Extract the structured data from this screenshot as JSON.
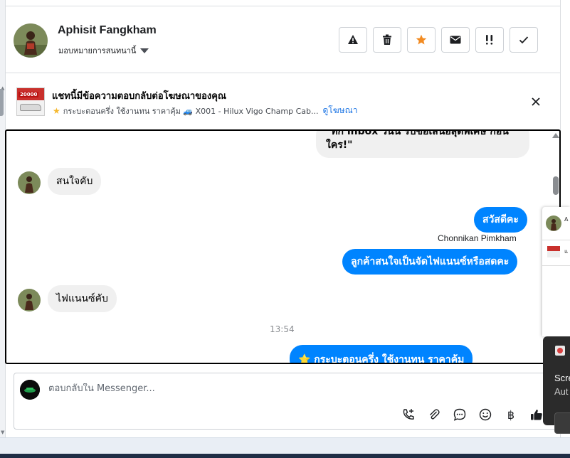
{
  "header": {
    "customer_name": "Aphisit Fangkham",
    "assign_label": "มอบหมายการสนทนานี้",
    "actions": [
      {
        "name": "report-spam-button",
        "icon": "warning-icon"
      },
      {
        "name": "delete-button",
        "icon": "trash-icon"
      },
      {
        "name": "star-button",
        "icon": "star-icon"
      },
      {
        "name": "mark-unread-button",
        "icon": "envelope-icon"
      },
      {
        "name": "follow-up-button",
        "icon": "important-icon"
      },
      {
        "name": "mark-done-button",
        "icon": "check-icon"
      }
    ]
  },
  "ad": {
    "title": "แชทนี้มีข้อความตอบกลับต่อโฆษณาของคุณ",
    "thumb_badge": "20000",
    "subtitle": "กระบะตอนครึ่ง ใช้งานทน ราคาคุ้ม 🚙 X001 - Hilux Vigo Champ Cab...",
    "link": "ดูโฆษณา"
  },
  "chat": {
    "top_bubble": "\"ทัก inbox วันนี้ รับข้อเสนอสุดพิเศษ ก่อนใคร!\"",
    "messages": [
      {
        "side": "in",
        "text": "สนใจคับ"
      },
      {
        "side": "out",
        "text": "สวัสดีคะ"
      },
      {
        "side": "out",
        "text": "ลูกค้าสนใจเป็นจัดไฟแนนซ์หรือสดคะ"
      },
      {
        "side": "in",
        "text": "ไฟแนนซ์คับ"
      },
      {
        "side": "out",
        "text": "⭐ กระบะตอนครึ่ง ใช้งานทน ราคาคุ้ม"
      }
    ],
    "sender_name": "Chonnikan Pimkham",
    "time_separator": "13:54"
  },
  "composer": {
    "placeholder": "ตอบกลับใน Messenger...",
    "tools": [
      {
        "name": "call-add-icon",
        "glyph": "📞"
      },
      {
        "name": "attach-icon",
        "glyph": "📎"
      },
      {
        "name": "saved-reply-icon",
        "glyph": "💬"
      },
      {
        "name": "emoji-icon",
        "glyph": "☺"
      },
      {
        "name": "baht-icon",
        "glyph": "฿"
      },
      {
        "name": "thumbs-up-icon",
        "glyph": "👍"
      }
    ]
  },
  "overlay": {
    "mini_name": "A",
    "mini_ad": "แ",
    "toast_line1": "Scre",
    "toast_line2": "Aut"
  },
  "colors": {
    "accent": "#0084ff",
    "star": "#f28b22",
    "link": "#1b74e4"
  }
}
